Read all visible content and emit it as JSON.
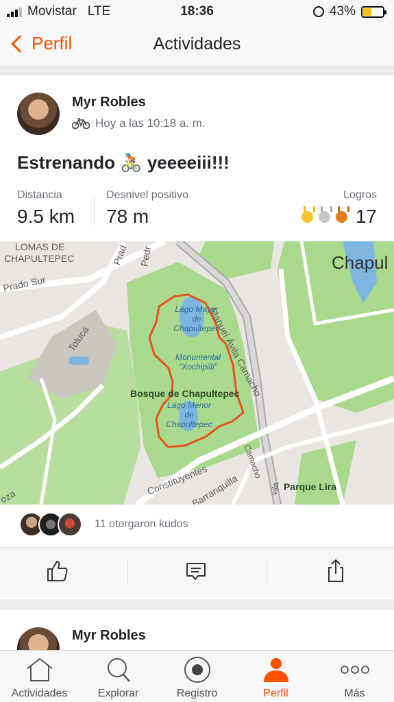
{
  "status_bar": {
    "carrier": "Movistar",
    "network": "LTE",
    "time": "18:36",
    "battery": "43%",
    "battery_level": 0.43,
    "signal_bars": 3
  },
  "nav": {
    "back_label": "Perfil",
    "title": "Actividades"
  },
  "activity": {
    "athlete_name": "Myr Robles",
    "activity_icon": "bike-icon",
    "timestamp": "Hoy a las 10:18 a. m.",
    "title": "Estrenando 🚴🏼 yeeeeiii!!!",
    "stats": {
      "distance_label": "Distancia",
      "distance_value": "9.5 km",
      "elevation_label": "Desnivel positivo",
      "elevation_value": "78 m",
      "achievements_label": "Logros",
      "achievements_value": "17"
    },
    "map_labels": {
      "lomas1": "LOMAS DE",
      "lomas2": "CHAPULTEPEC",
      "prado": "Prado Sur",
      "prad": "Prad",
      "pedr": "Pedr",
      "toluca": "Toluca",
      "manuel": "Manuel Ávila Camacho",
      "chapul": "Chapul",
      "lago_mayor": "Lago Mayor de Chapultepec",
      "monumental": "Monumental \"Xochipilli\"",
      "bosque": "Bosque de Chapultepec",
      "lago_menor": "Lago Menor de Chapultepec",
      "constituyentes": "Constituyentes",
      "barranquilla": "Barranquilla",
      "camacho": "Camacho",
      "avila": "vila",
      "parque_lira": "Parque Lira",
      "roza": "oza"
    },
    "kudos_text": "11 otorgaron kudos",
    "actions": [
      "thumbs-up-icon",
      "comment-icon",
      "share-icon"
    ]
  },
  "next_activity": {
    "athlete_name": "Myr Robles"
  },
  "tabbar": [
    {
      "label": "Actividades",
      "icon": "home-icon",
      "active": false
    },
    {
      "label": "Explorar",
      "icon": "search-icon",
      "active": false
    },
    {
      "label": "Registro",
      "icon": "record-icon",
      "active": false
    },
    {
      "label": "Perfil",
      "icon": "profile-icon",
      "active": true
    },
    {
      "label": "Más",
      "icon": "more-icon",
      "active": false
    }
  ],
  "colors": {
    "accent": "#fc5200",
    "route": "#e8521f",
    "park": "#a8d98c",
    "water": "#7fb6e0"
  }
}
